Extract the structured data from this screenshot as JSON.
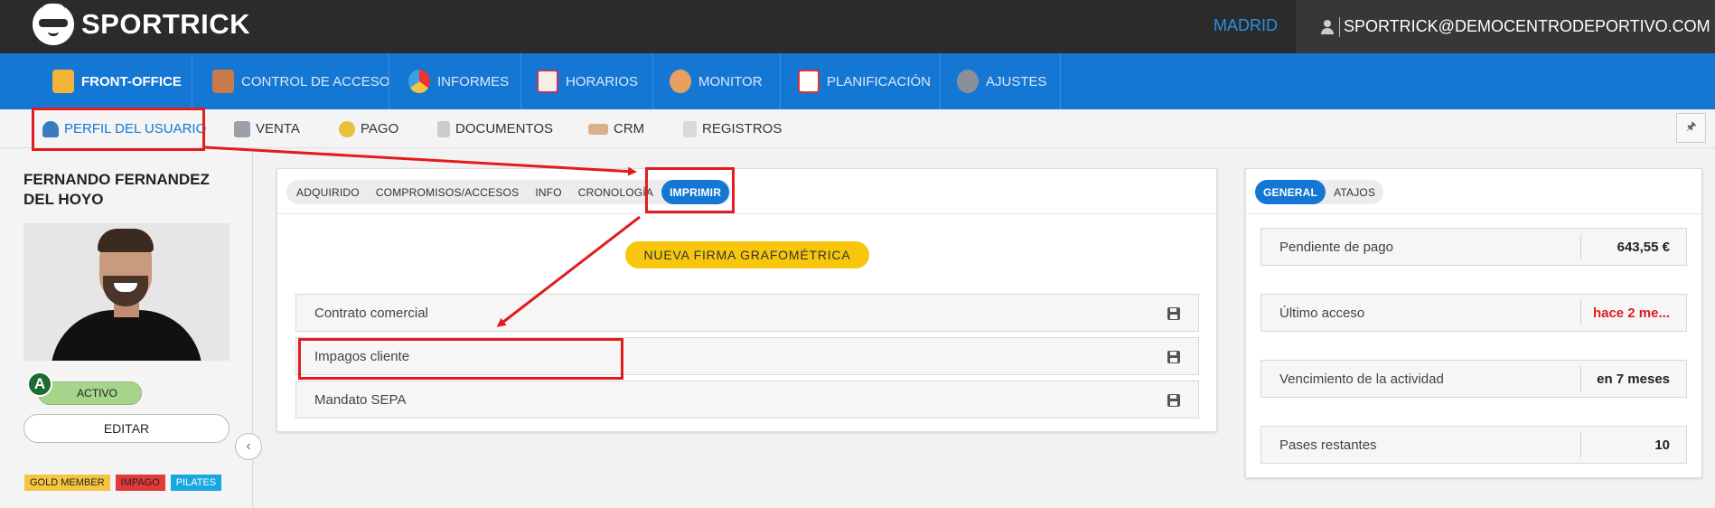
{
  "header": {
    "brand": "SPORTRICK",
    "city": "MADRID",
    "user_email": "SPORTRICK@DEMOCENTRODEPORTIVO.COM"
  },
  "main_nav": [
    {
      "label": "FRONT-OFFICE",
      "icon": "front-office-icon",
      "active": true
    },
    {
      "label": "CONTROL DE ACCESO",
      "icon": "access-control-icon"
    },
    {
      "label": "INFORMES",
      "icon": "pie-chart-icon"
    },
    {
      "label": "HORARIOS",
      "icon": "calendar-grid-icon"
    },
    {
      "label": "MONITOR",
      "icon": "people-icon"
    },
    {
      "label": "PLANIFICACIÓN",
      "icon": "calendar-icon"
    },
    {
      "label": "AJUSTES",
      "icon": "gear-icon"
    }
  ],
  "sub_nav": [
    {
      "label": "PERFIL DEL USUARIO",
      "icon": "user-profile-icon",
      "active": true
    },
    {
      "label": "VENTA",
      "icon": "cash-register-icon"
    },
    {
      "label": "PAGO",
      "icon": "coin-icon"
    },
    {
      "label": "DOCUMENTOS",
      "icon": "document-icon"
    },
    {
      "label": "CRM",
      "icon": "handshake-icon"
    },
    {
      "label": "REGISTROS",
      "icon": "clipboard-icon"
    }
  ],
  "client": {
    "name": "FERNANDO FERNANDEZ DEL HOYO",
    "level_badge": "A",
    "status": "ACTIVO",
    "edit_label": "EDITAR",
    "tags": [
      {
        "label": "GOLD MEMBER",
        "color": "#f5c542"
      },
      {
        "label": "IMPAGO",
        "color": "#e23a3a"
      },
      {
        "label": "PILATES",
        "color": "#18a7e0"
      }
    ]
  },
  "center": {
    "tabs": [
      {
        "label": "ADQUIRIDO"
      },
      {
        "label": "COMPROMISOS/ACCESOS"
      },
      {
        "label": "INFO"
      },
      {
        "label": "CRONOLOGÍA"
      },
      {
        "label": "IMPRIMIR",
        "active": true
      }
    ],
    "firma_button": "NUEVA FIRMA GRAFOMÉTRICA",
    "documents": [
      {
        "label": "Contrato comercial",
        "icon": "save-icon"
      },
      {
        "label": "Impagos cliente",
        "icon": "save-icon"
      },
      {
        "label": "Mandato SEPA",
        "icon": "save-icon"
      }
    ]
  },
  "right": {
    "tabs": [
      {
        "label": "GENERAL",
        "active": true
      },
      {
        "label": "ATAJOS"
      }
    ],
    "stats": [
      {
        "label": "Pendiente de pago",
        "value": "643,55 €"
      },
      {
        "label": "Último acceso",
        "value": "hace 2 me...",
        "highlight": "#e11c1c"
      },
      {
        "label": "Vencimiento de la actividad",
        "value": "en 7 meses"
      },
      {
        "label": "Pases restantes",
        "value": "10"
      }
    ]
  },
  "colors": {
    "primary": "#1577d4",
    "topbar": "#2b2b2b",
    "accent_yellow": "#f7c60d",
    "annotation_red": "#e11c1c"
  }
}
